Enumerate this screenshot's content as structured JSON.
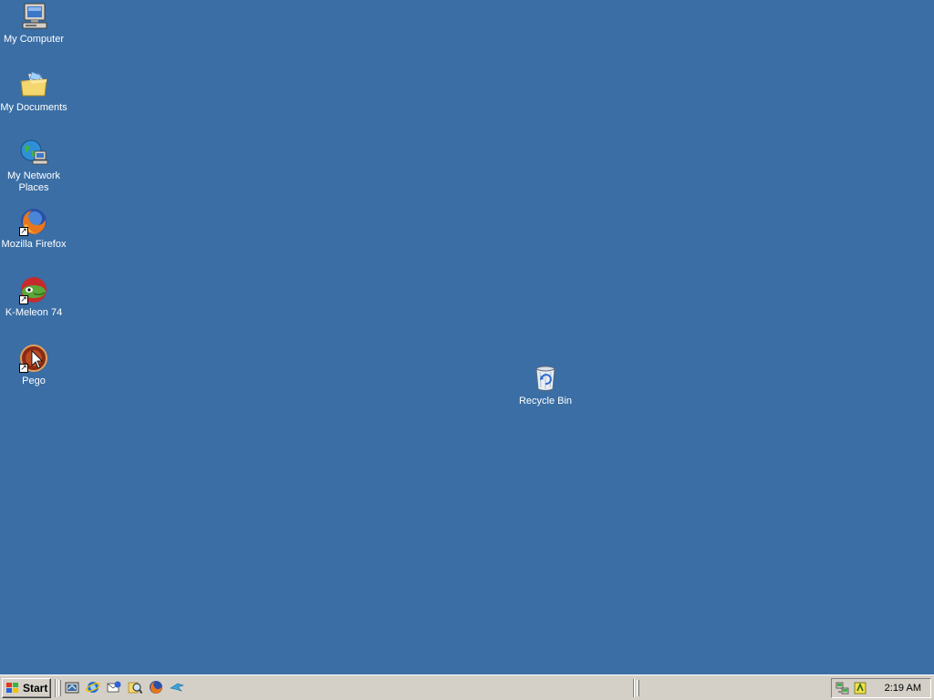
{
  "desktop": {
    "background_color": "#3a6ea5",
    "icons": [
      {
        "label": "My Computer",
        "icon": "computer-icon"
      },
      {
        "label": "My Documents",
        "icon": "folder-icon"
      },
      {
        "label": "My Network Places",
        "icon": "network-icon"
      },
      {
        "label": "Mozilla Firefox",
        "icon": "firefox-icon",
        "shortcut": true
      },
      {
        "label": "K-Meleon 74",
        "icon": "k-meleon-icon",
        "shortcut": true
      },
      {
        "label": "Pego",
        "icon": "pego-icon",
        "shortcut": true
      },
      {
        "label": "Recycle Bin",
        "icon": "recycle-bin-icon"
      }
    ]
  },
  "taskbar": {
    "start_label": "Start",
    "quick_launch": [
      "show-desktop-icon",
      "internet-explorer-icon",
      "outlook-express-icon",
      "search-icon",
      "firefox-icon",
      "media-icon"
    ],
    "tray": {
      "icons": [
        "network-connection-icon",
        "shield-icon"
      ],
      "clock": "2:19 AM"
    }
  }
}
